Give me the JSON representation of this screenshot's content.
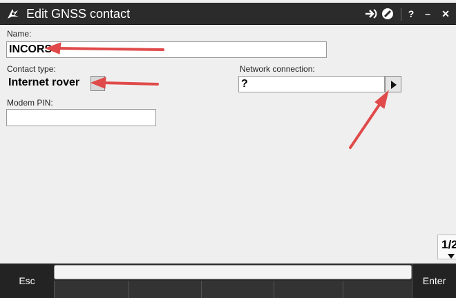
{
  "window": {
    "title": "Edit GNSS contact",
    "controls": {
      "help": "?",
      "minimize": "–",
      "close": "✕"
    }
  },
  "form": {
    "name": {
      "label": "Name:",
      "value": "INCORS"
    },
    "contact_type": {
      "label": "Contact type:",
      "value": "Internet rover"
    },
    "network_connection": {
      "label": "Network connection:",
      "value": "?"
    },
    "modem_pin": {
      "label": "Modem PIN:",
      "value": ""
    }
  },
  "page_indicator": "1/2",
  "softkeys": {
    "esc": "Esc",
    "enter": "Enter"
  },
  "colors": {
    "annotation_arrow": "#e04a4a",
    "titlebar": "#2b2b2b",
    "bottombar": "#2a2a2a"
  },
  "icons": [
    "app-logo-icon",
    "forward-icon",
    "status-icon",
    "chevron-right-icon",
    "chevron-down-icon"
  ]
}
